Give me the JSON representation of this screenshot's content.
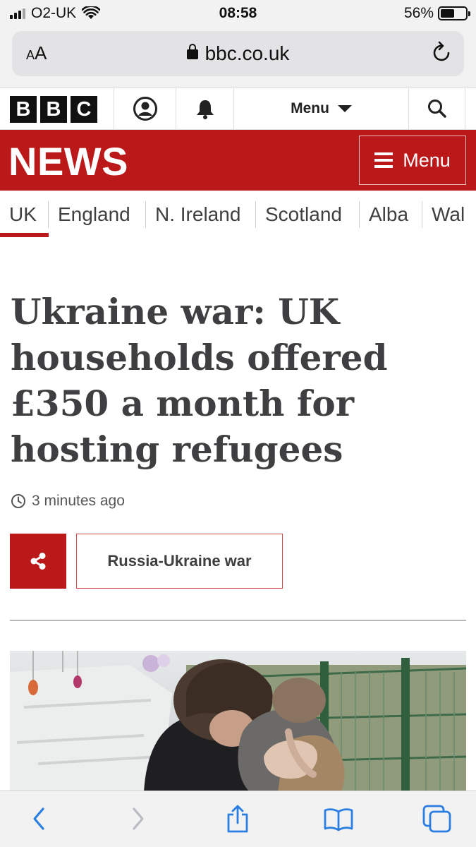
{
  "status_bar": {
    "carrier": "O2-UK",
    "time": "08:58",
    "battery": "56%",
    "battery_level": 0.56
  },
  "browser": {
    "aa_label_small": "A",
    "aa_label_large": "A",
    "url": "bbc.co.uk"
  },
  "bbc_bar": {
    "logo_letters": [
      "B",
      "B",
      "C"
    ],
    "menu_label": "Menu"
  },
  "news_header": {
    "title": "NEWS",
    "menu_label": "Menu"
  },
  "nav": {
    "items": [
      "UK",
      "England",
      "N. Ireland",
      "Scotland",
      "Alba",
      "Wal"
    ],
    "active_index": 0
  },
  "article": {
    "headline": "Ukraine war: UK households offered £350 a month for hosting refugees",
    "timestamp": "3 minutes ago",
    "tag": "Russia-Ukraine war"
  },
  "colors": {
    "brand_red": "#bb1919",
    "text_dark": "#3f3f42",
    "ios_blue": "#2a7de1"
  },
  "icons": {
    "account": "account-icon",
    "notifications": "bell-icon",
    "search": "search-icon",
    "share": "share-icon",
    "clock": "clock-icon"
  }
}
